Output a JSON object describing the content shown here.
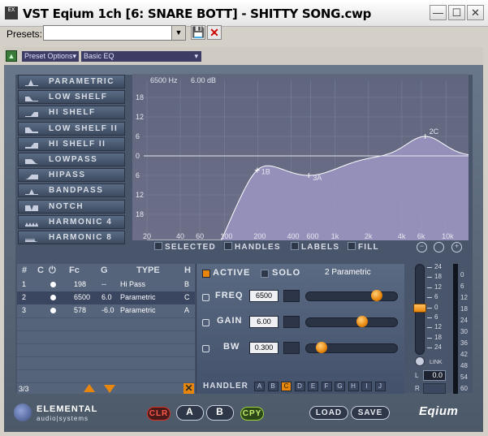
{
  "window": {
    "title": "VST Eqium 1ch [6: SNARE BOTT] - SHITTY SONG.cwp",
    "app_icon": "EX",
    "buttons": {
      "minimize": "—",
      "maximize": "☐",
      "close": "✕"
    }
  },
  "presets": {
    "label": "Presets:",
    "value": "",
    "icons": [
      "save-icon",
      "delete-icon"
    ]
  },
  "options": {
    "preset_options": "Preset Options",
    "preset_name": "Basic EQ"
  },
  "filter_types": [
    "PARAMETRIC",
    "LOW SHELF",
    "HI SHELF",
    "LOW SHELF II",
    "HI SHELF II",
    "LOWPASS",
    "HIPASS",
    "BANDPASS",
    "NOTCH",
    "HARMONIC 4",
    "HARMONIC 8"
  ],
  "graph": {
    "cursor_freq": "6500 Hz",
    "cursor_gain": "6.00 dB",
    "db_labels": [
      "18",
      "12",
      "6",
      "0",
      "6",
      "12",
      "18"
    ],
    "freq_labels": [
      "20",
      "40",
      "60",
      "100",
      "200",
      "400",
      "600",
      "1k",
      "2k",
      "4k",
      "6k",
      "10k"
    ],
    "handles": [
      "1B",
      "3A",
      "2C"
    ],
    "options": [
      "SELECTED",
      "HANDLES",
      "LABELS",
      "FILL"
    ],
    "icons": [
      "zoom-out-icon",
      "zoom-fit-icon",
      "zoom-in-icon"
    ]
  },
  "band_table": {
    "headers": [
      "#",
      "C",
      "⏻",
      "Fc",
      "G",
      "TYPE",
      "H"
    ],
    "rows": [
      {
        "num": "1",
        "fc": "198",
        "g": "--",
        "type": "Hi Pass",
        "h": "B"
      },
      {
        "num": "2",
        "fc": "6500",
        "g": "6.0",
        "type": "Parametric",
        "h": "C"
      },
      {
        "num": "3",
        "fc": "578",
        "g": "-6.0",
        "type": "Parametric",
        "h": "A"
      }
    ],
    "count": "3/3"
  },
  "params": {
    "active_label": "ACTIVE",
    "solo_label": "SOLO",
    "band_name": "2 Parametric",
    "freq_label": "FREQ",
    "freq_value": "6500",
    "freq_pos": 0.8,
    "gain_label": "GAIN",
    "gain_value": "6.00",
    "gain_pos": 0.62,
    "bw_label": "BW",
    "bw_value": "0.300",
    "bw_pos": 0.12,
    "handler_label": "HANDLER",
    "handlers": [
      "A",
      "B",
      "C",
      "D",
      "E",
      "F",
      "G",
      "H",
      "I",
      "J"
    ],
    "selected_handler": "C"
  },
  "master": {
    "scale": [
      "24",
      "18",
      "12",
      "6",
      "0",
      "6",
      "12",
      "18",
      "24"
    ],
    "link_label": "LINK",
    "l_label": "L",
    "r_label": "R",
    "gain_value": "0.0"
  },
  "meter": {
    "scale": [
      "0",
      "6",
      "12",
      "18",
      "24",
      "30",
      "36",
      "42",
      "48",
      "54",
      "60"
    ]
  },
  "footer": {
    "brand_line1": "ELEMENTAL",
    "brand_line2": "audio|systems",
    "clr": "CLR",
    "a": "A",
    "b": "B",
    "cpy": "CPY",
    "load": "LOAD",
    "save": "SAVE",
    "product": "Eqium"
  },
  "colors": {
    "accent": "#e8860c",
    "panel": "#48556a",
    "graph_fill": "#9c97c3"
  }
}
